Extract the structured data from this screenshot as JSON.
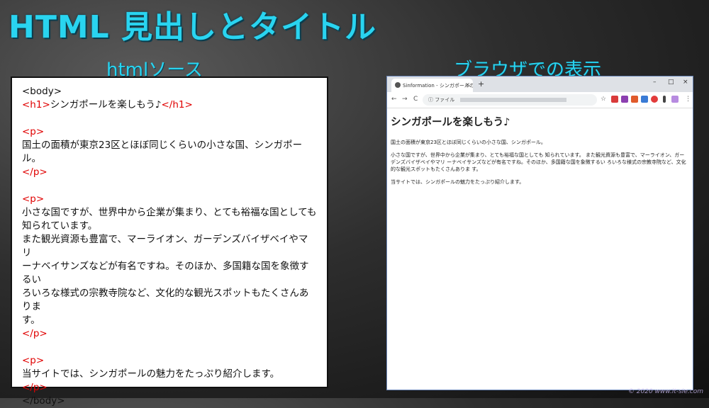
{
  "slide": {
    "title": "HTML 見出しとタイトル",
    "source_label": "htmlソース",
    "browser_label": "ブラウザでの表示",
    "watermark": "© 2020 www.it-sie.com"
  },
  "source": {
    "body_open": "<body>",
    "h1_open": "<h1>",
    "h1_text": "シンガポールを楽しもう♪",
    "h1_close": "</h1>",
    "p_open": "<p>",
    "p_close": "</p>",
    "p1_text": "国土の面積が東京23区とほぼ同じくらいの小さな国、シンガポール。",
    "p2_line1": "小さな国ですが、世界中から企業が集まり、とても裕福な国としても",
    "p2_line2": "知られています。",
    "p2_line3": "また観光資源も豊富で、マーライオン、ガーデンズバイザベイやマリ",
    "p2_line4": "ーナベイサンズなどが有名ですね。そのほか、多国籍な国を象徴するい",
    "p2_line5": "ろいろな様式の宗教寺院など、文化的な観光スポットもたくさんありま",
    "p2_line6": "す。",
    "p3_text": "当サイトでは、シンガポールの魅力をたっぷり紹介します。",
    "body_close": "</body>"
  },
  "browser": {
    "tab_title": "Sinformation - シンガポールの観光",
    "tab_close": "×",
    "new_tab": "+",
    "win_min": "–",
    "win_max": "□",
    "win_close": "×",
    "back": "←",
    "forward": "→",
    "reload": "C",
    "info": "ⓘ",
    "address_label": "ファイル",
    "star": "☆",
    "menu": "⋮",
    "page": {
      "h1": "シンガポールを楽しもう♪",
      "p1": "国土の面積が東京23区とほぼ同じくらいの小さな国、シンガポール。",
      "p2": "小さな国ですが、世界中から企業が集まり、とても裕福な国としても 知られています。 また観光資源も豊富で、マーライオン、ガーデンズバイザベイやマリ ーナベイサンズなどが有名ですね。そのほか、多国籍な国を象徴するい ろいろな様式の宗教寺院など、文化的な観光スポットもたくさんありま す。",
      "p3": "当サイトでは、シンガポールの魅力をたっぷり紹介します。"
    }
  },
  "colors": {
    "accent": "#29d4f0",
    "tag": "#e00000"
  }
}
